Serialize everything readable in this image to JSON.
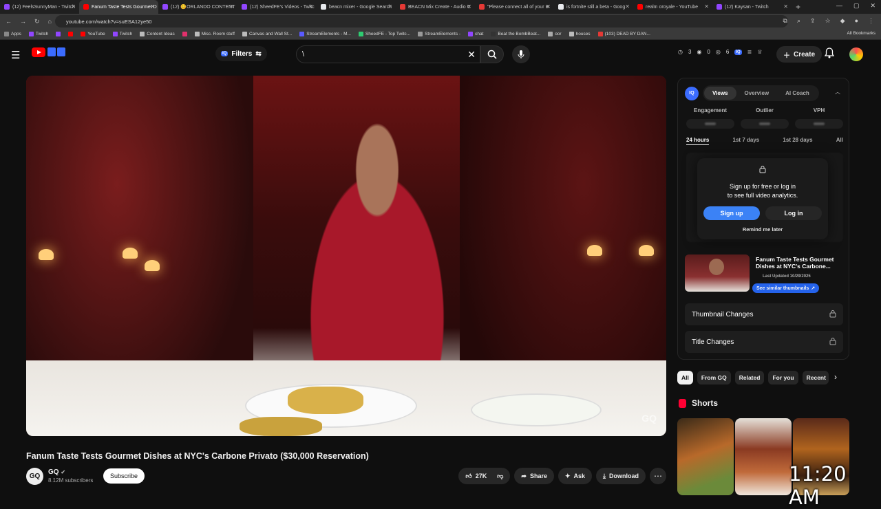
{
  "browser": {
    "tabs": [
      {
        "title": "(12) FeelsSunnyMan - Twitch",
        "color": "#9146ff",
        "active": false
      },
      {
        "title": "Fanum Taste Tests Gourmet D",
        "color": "#ff0000",
        "active": true
      },
      {
        "title": "(12) 😊ORLANDO CONTENT",
        "color": "#9146ff",
        "active": false
      },
      {
        "title": "(12) SheedFE's Videos - Twitc",
        "color": "#9146ff",
        "active": false
      },
      {
        "title": "beacn mixer - Google Search",
        "color": "#e8eaed",
        "active": false
      },
      {
        "title": "BEACN Mix Create - Audio C",
        "color": "#e53935",
        "active": false
      },
      {
        "title": "\"Please connect all of your B",
        "color": "#e53935",
        "active": false
      },
      {
        "title": "is fortnite still a beta - Goog",
        "color": "#e8eaed",
        "active": false
      },
      {
        "title": "realm oroyale - YouTube",
        "color": "#ff0000",
        "active": false
      },
      {
        "title": "(12) Kaysan - Twitch",
        "color": "#9146ff",
        "active": false
      }
    ],
    "url": "youtube.com/watch?v=suESA12ye50",
    "bookmarks": [
      {
        "label": "Apps",
        "color": "#888"
      },
      {
        "label": "Twitch",
        "color": "#9146ff"
      },
      {
        "label": "",
        "color": "#9146ff"
      },
      {
        "label": "",
        "color": "#ff0000"
      },
      {
        "label": "YouTube",
        "color": "#ff0000"
      },
      {
        "label": "Twitch",
        "color": "#9146ff"
      },
      {
        "label": "Content Ideas",
        "color": "#bbb"
      },
      {
        "label": "",
        "color": "#e1306c"
      },
      {
        "label": "Misc. Room stuff",
        "color": "#bbb"
      },
      {
        "label": "Canvas and Wall St...",
        "color": "#bbb"
      },
      {
        "label": "StreamElements - M...",
        "color": "#5a5aff"
      },
      {
        "label": "SheedFE - Top Twitc...",
        "color": "#2ecc71"
      },
      {
        "label": "StreamElements -",
        "color": "#999"
      },
      {
        "label": "chat",
        "color": "#9146ff"
      },
      {
        "label": "Beat the BombBeat...",
        "color": "#333"
      },
      {
        "label": "oor",
        "color": "#aaa"
      },
      {
        "label": "houses",
        "color": "#bbb"
      },
      {
        "label": "(103) DEAD BY DAN...",
        "color": "#e53935"
      }
    ],
    "all_bookmarks": "All Bookmarks"
  },
  "header": {
    "filters_label": "Filters",
    "search_value": "\\",
    "stats": {
      "views": "3",
      "eye": "0",
      "other": "6"
    },
    "create_label": "Create"
  },
  "video": {
    "title": "Fanum Taste Tests Gourmet Dishes at NYC's Carbone Privato ($30,000 Reservation)",
    "channel_avatar": "GQ",
    "channel": "GQ",
    "subscribers": "8.12M subscribers",
    "subscribe_label": "Subscribe",
    "likes": "27K",
    "share_label": "Share",
    "ask_label": "Ask",
    "download_label": "Download",
    "watermark": "GQ"
  },
  "panel": {
    "badge": "IQ",
    "tabs": [
      "Views",
      "Overview",
      "AI Coach"
    ],
    "metrics": [
      "Engagement",
      "Outlier",
      "VPH"
    ],
    "ranges": [
      "24 hours",
      "1st 7 days",
      "1st 28 days",
      "All"
    ],
    "lock_message_1": "Sign up for free or log in",
    "lock_message_2": "to see full video analytics.",
    "signup_label": "Sign up",
    "login_label": "Log in",
    "remind_label": "Remind me later",
    "thumb_title": "Fanum Taste Tests Gourmet Dishes at NYC's Carbone...",
    "last_updated": "Last Updated 10/29/2025",
    "similar_label": "See similar thumbnails",
    "thumbnail_changes": "Thumbnail Changes",
    "title_changes": "Title Changes"
  },
  "chips": [
    "All",
    "From GQ",
    "Related",
    "For you",
    "Recent"
  ],
  "shorts_label": "Shorts",
  "overlay_clock": "11:20 AM"
}
